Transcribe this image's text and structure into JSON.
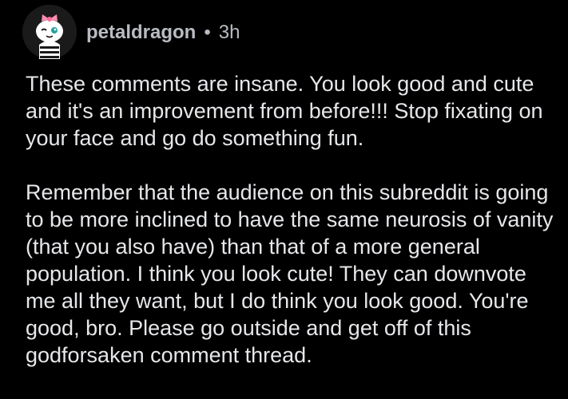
{
  "comment": {
    "author": "petaldragon",
    "separator": "•",
    "age": "3h",
    "paragraphs": [
      "These comments are insane. You look good and cute and it's an improvement from before!!! Stop fixating on your face and go do something fun.",
      "Remember that the audience on this subreddit is going to be more inclined to have the same neurosis of vanity (that you also have) than that of a more general population. I think you look cute! They can downvote me all they want, but I do think you look good. You're good, bro. Please go outside and get off of this godforsaken comment thread."
    ],
    "avatar_icon": "snoo-avatar-with-pink-bow-icon"
  },
  "colors": {
    "background": "#000000",
    "text": "#e6e7ea",
    "meta": "#b9bcc2",
    "avatar_bg": "#1a1a1b",
    "bow": "#ff8fb1",
    "eye": "#24a0a0"
  }
}
